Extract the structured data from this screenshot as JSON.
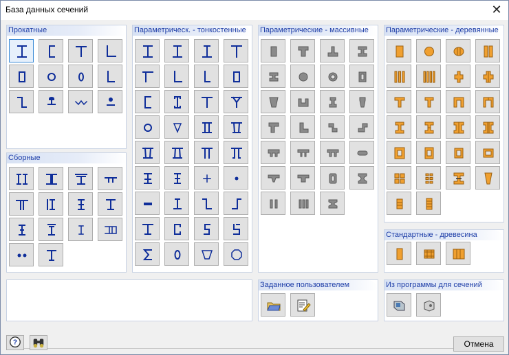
{
  "window": {
    "title": "База данных сечений"
  },
  "groups": {
    "rolled": "Прокатные",
    "built_up": "Сборные",
    "param_thin": "Параметрическ. - тонкостенные",
    "param_massive": "Параметрические - массивные",
    "param_timber": "Параметрические - деревянные",
    "std_timber": "Стандартные - древесина",
    "user_defined": "Заданное пользователем",
    "from_program": "Из программы для сечений"
  },
  "footer": {
    "cancel_label": "Отмена"
  },
  "colors": {
    "accent_title": "#1e3ea8",
    "shape_blue": "#0f2e9a",
    "timber_orange": "#f0a030",
    "massive_gray": "#8a8a8a"
  }
}
